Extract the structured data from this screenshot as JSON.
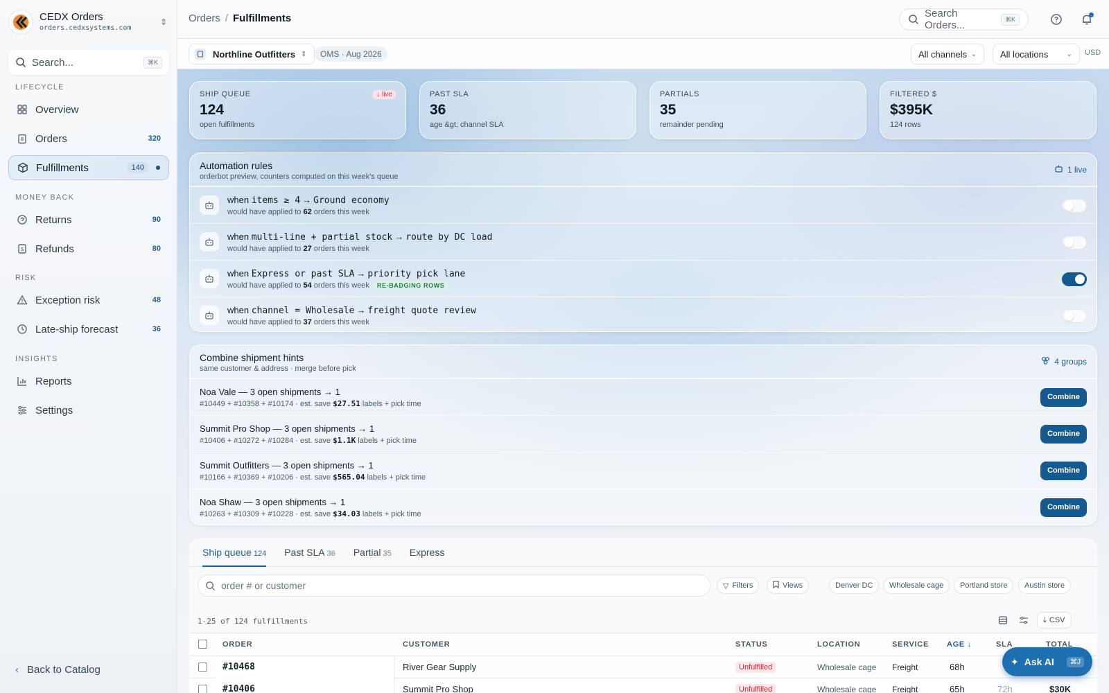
{
  "brand": {
    "title": "CEDX Orders",
    "domain": "orders.cedxsystems.com"
  },
  "sidebar": {
    "search_placeholder": "Search...",
    "search_kbd": "⌘K",
    "sections": {
      "lifecycle": "LIFECYCLE",
      "money_back": "MONEY BACK",
      "risk": "RISK",
      "insights": "INSIGHTS"
    },
    "items": {
      "overview": {
        "label": "Overview"
      },
      "orders": {
        "label": "Orders",
        "count": "320"
      },
      "fulfillments": {
        "label": "Fulfillments",
        "count": "140"
      },
      "returns": {
        "label": "Returns",
        "count": "90"
      },
      "refunds": {
        "label": "Refunds",
        "count": "80"
      },
      "exception_risk": {
        "label": "Exception risk",
        "count": "48"
      },
      "late_ship": {
        "label": "Late-ship forecast",
        "count": "36"
      },
      "reports": {
        "label": "Reports"
      },
      "settings": {
        "label": "Settings"
      }
    },
    "back_label": "Back to Catalog"
  },
  "topbar": {
    "crumb_parent": "Orders",
    "crumb_sep": "/",
    "crumb_current": "Fulfillments",
    "search_placeholder": "Search Orders...",
    "search_kbd": "⌘K"
  },
  "subbar": {
    "org": "Northline Outfitters",
    "period_tag": "OMS · Aug 2026",
    "channel_select": "All channels",
    "location_select": "All locations",
    "currency": "USD"
  },
  "kpis": [
    {
      "label": "SHIP QUEUE",
      "value": "124",
      "sub": "open fulfillments",
      "badge": "↓ live"
    },
    {
      "label": "PAST SLA",
      "value": "36",
      "sub": "age &gt; channel SLA"
    },
    {
      "label": "PARTIALS",
      "value": "35",
      "sub": "remainder pending"
    },
    {
      "label": "FILTERED $",
      "value": "$395K",
      "sub": "124 rows"
    }
  ],
  "automation": {
    "title": "Automation rules",
    "subtitle": "orderbot preview, counters computed on this week's queue",
    "live_label": "1 live",
    "applied_prefix": "would have applied to",
    "applied_suffix": "orders this week",
    "rules": [
      {
        "when": "when",
        "cond": "items ≥ 4",
        "arrow": "→",
        "action": "Ground economy",
        "count": "62",
        "enabled": false
      },
      {
        "when": "when",
        "cond": "multi-line + partial stock",
        "arrow": "→",
        "action": "route by DC load",
        "count": "27",
        "enabled": false
      },
      {
        "when": "when",
        "cond": "Express or past SLA",
        "arrow": "→",
        "action": "priority pick lane",
        "count": "54",
        "enabled": true,
        "tag": "RE-BADGING ROWS"
      },
      {
        "when": "when",
        "cond": "channel = Wholesale",
        "arrow": "→",
        "action": "freight quote review",
        "count": "37",
        "enabled": false
      }
    ]
  },
  "combine": {
    "title": "Combine shipment hints",
    "subtitle": "same customer & address · merge before pick",
    "groups_label": "4 groups",
    "button_label": "Combine",
    "save_prefix": "est. save",
    "save_suffix": "labels + pick time",
    "rows": [
      {
        "title": "Noa Vale — 3 open shipments → 1",
        "orders": "#10449 + #10358 + #10174 ·",
        "save": "$27.51"
      },
      {
        "title": "Summit Pro Shop — 3 open shipments → 1",
        "orders": "#10406 + #10272 + #10284 ·",
        "save": "$1.1K"
      },
      {
        "title": "Summit Outfitters — 3 open shipments → 1",
        "orders": "#10166 + #10369 + #10206 ·",
        "save": "$565.04"
      },
      {
        "title": "Noa Shaw — 3 open shipments → 1",
        "orders": "#10263 + #10309 + #10228 ·",
        "save": "$34.03"
      }
    ]
  },
  "table": {
    "tabs": [
      {
        "label": "Ship queue",
        "count": "124"
      },
      {
        "label": "Past SLA",
        "count": "36"
      },
      {
        "label": "Partial",
        "count": "35"
      },
      {
        "label": "Express",
        "count": ""
      }
    ],
    "search_placeholder": "order # or customer",
    "filters_label": "Filters",
    "views_label": "Views",
    "chips": [
      "Denver DC",
      "Wholesale cage",
      "Portland store",
      "Austin store"
    ],
    "meta": "1-25 of 124 fulfillments",
    "csv_label": "CSV",
    "headers": {
      "order": "ORDER",
      "customer": "CUSTOMER",
      "status": "STATUS",
      "location": "LOCATION",
      "service": "SERVICE",
      "age": "AGE",
      "age_sort": "↓",
      "sla": "SLA",
      "total": "TOTAL"
    },
    "rows": [
      {
        "order": "#10468",
        "customer": "River Gear Supply",
        "status": "Unfulfilled",
        "location": "Wholesale cage",
        "service": "Freight",
        "age": "68h",
        "sla": "",
        "total": ""
      },
      {
        "order": "#10406",
        "customer": "Summit Pro Shop",
        "status": "Unfulfilled",
        "location": "Wholesale cage",
        "service": "Freight",
        "age": "65h",
        "sla": "72h",
        "total": "$30K"
      }
    ]
  },
  "ask_ai": {
    "label": "Ask AI",
    "kbd": "⌘J"
  }
}
